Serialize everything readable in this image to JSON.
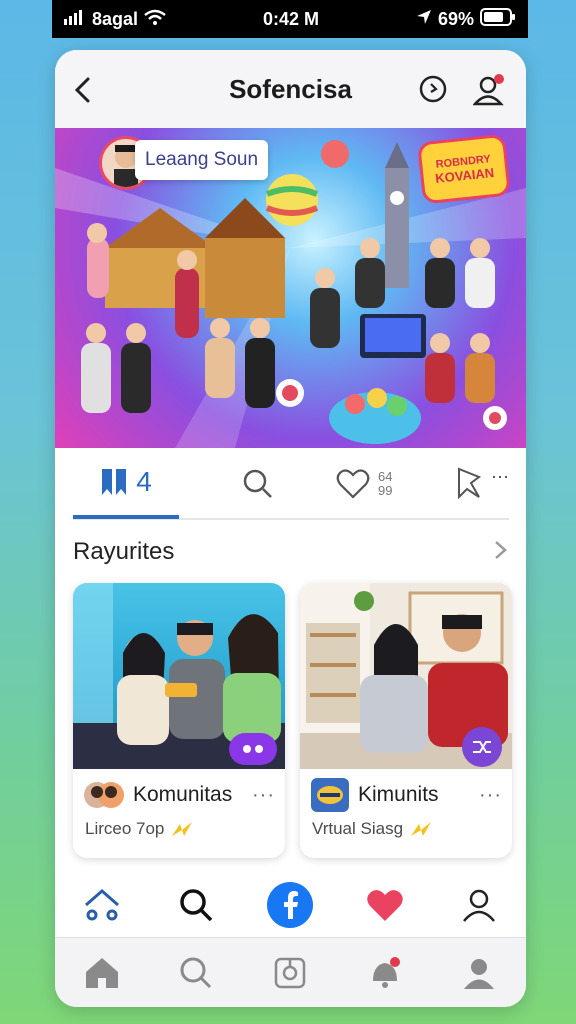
{
  "status": {
    "signal": "8agal",
    "time": "0:42 M",
    "battery": "69%"
  },
  "header": {
    "title": "Sofencisa"
  },
  "banner": {
    "chip": "Leaang Soun",
    "badge_line1": "ROBNDRY",
    "badge_line2": "KOVAIAN"
  },
  "tabs": [
    {
      "label": "4",
      "icon": "bookmark-icon",
      "active": true
    },
    {
      "label": "",
      "icon": "search-icon"
    },
    {
      "label_top": "64",
      "label_bottom": "99",
      "icon": "heart-icon"
    },
    {
      "label": "···",
      "icon": "share-icon"
    }
  ],
  "section": {
    "title": "Rayurites"
  },
  "cards": [
    {
      "name": "Komunitas",
      "sub": "Lirceo 7op",
      "more": "···"
    },
    {
      "name": "Kimunits",
      "sub": "Vrtual Siasg",
      "more": "···"
    }
  ],
  "colors": {
    "accent": "#2b6cc2",
    "like": "#e94361",
    "fb": "#1877f2"
  }
}
